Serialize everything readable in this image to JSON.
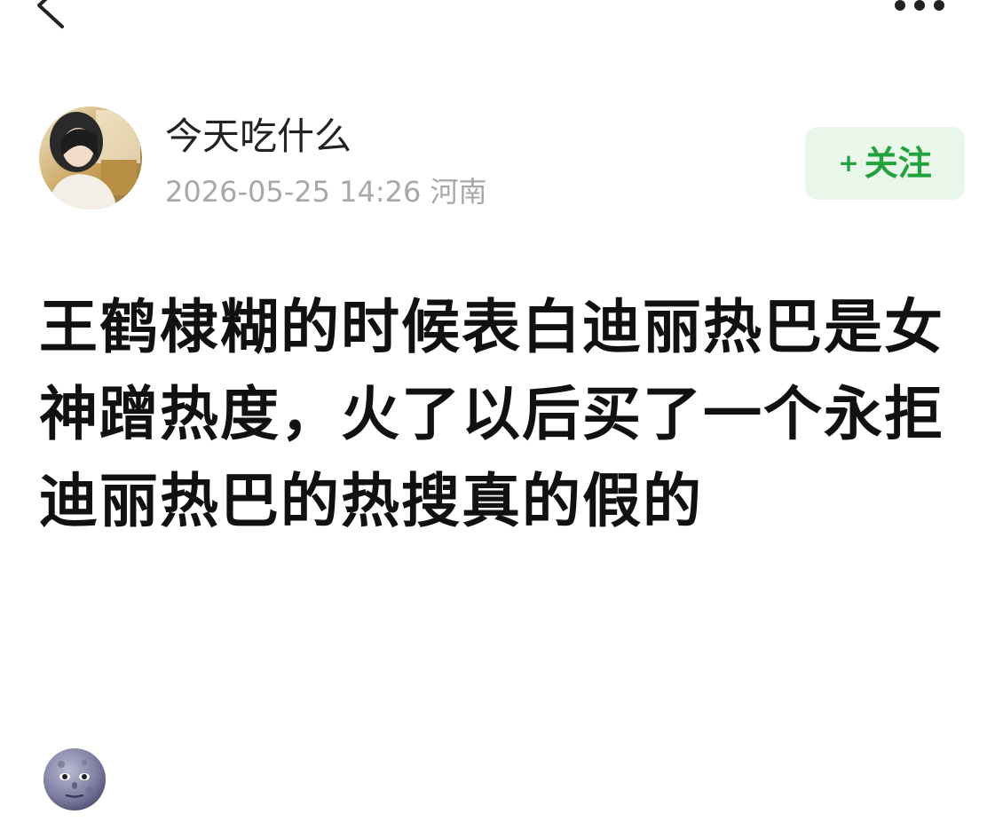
{
  "author": {
    "name": "今天吃什么",
    "timestamp": "2026-05-25 14:26",
    "location": "河南"
  },
  "follow_button": {
    "plus": "+",
    "label": "关注"
  },
  "post": {
    "text": "王鹤棣糊的时候表白迪丽热巴是女神蹭热度，火了以后买了一个永拒迪丽热巴的热搜真的假的",
    "emoji": "new-moon-face"
  },
  "colors": {
    "accent": "#23a13a",
    "follow_bg": "#e9f6ea",
    "meta_text": "#a8a8a8"
  },
  "icons": {
    "back": "back-chevron-icon",
    "more": "more-dots-icon"
  }
}
